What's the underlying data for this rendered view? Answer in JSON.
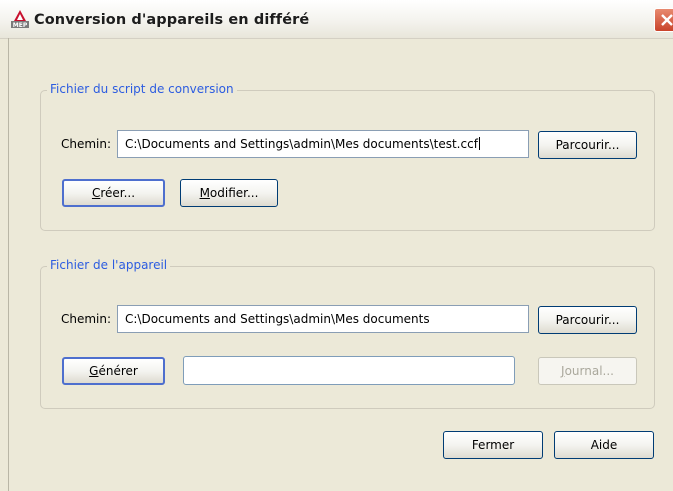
{
  "window": {
    "title": "Conversion d'appareils en différé",
    "icon_label": "MEP"
  },
  "script_group": {
    "legend": "Fichier du script de conversion",
    "path_label": "Chemin:",
    "path_value": "C:\\Documents and Settings\\admin\\Mes documents\\test.ccf",
    "browse_label": "Parcourir...",
    "create_mnemonic": "C",
    "create_rest": "réer...",
    "modify_mnemonic": "M",
    "modify_rest": "odifier..."
  },
  "device_group": {
    "legend": "Fichier de l'appareil",
    "path_label": "Chemin:",
    "path_value": "C:\\Documents and Settings\\admin\\Mes documents",
    "browse_label": "Parcourir...",
    "generate_mnemonic": "G",
    "generate_rest": "énérer",
    "status_value": "",
    "log_mnemonic": "J",
    "log_rest": "ournal...",
    "log_enabled": false
  },
  "footer": {
    "close_label": "Fermer",
    "help_label": "Aide"
  },
  "colors": {
    "accent": "#2c5ce0",
    "close_button": "#c9432a"
  }
}
